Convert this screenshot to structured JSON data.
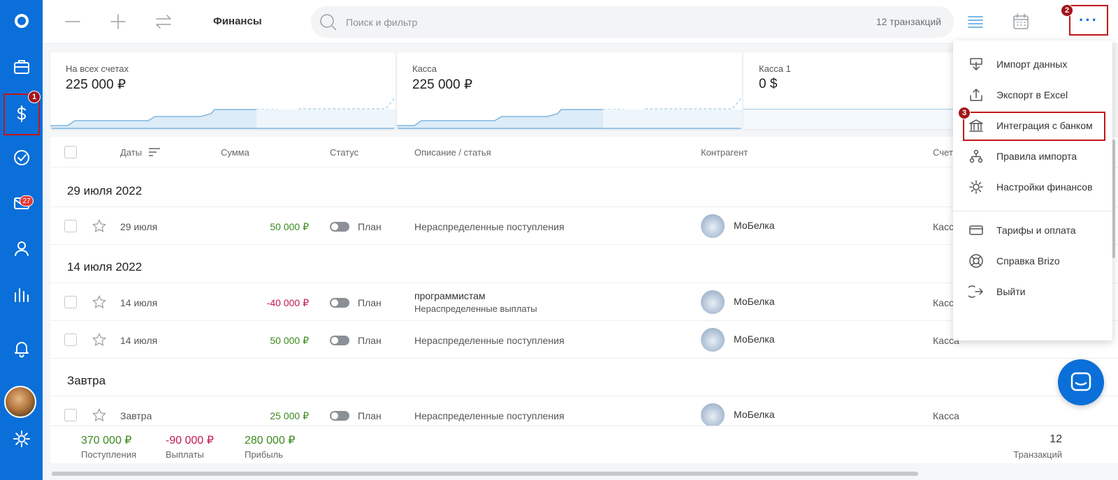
{
  "header": {
    "title": "Финансы",
    "search_placeholder": "Поиск и фильтр",
    "transaction_count": "12 транзакций",
    "more_label": "···"
  },
  "sidebar": {
    "mail_badge": "27"
  },
  "steps": {
    "s1": "1",
    "s2": "2",
    "s3": "3"
  },
  "cards": [
    {
      "label": "На всех счетах",
      "value": "225 000 ₽"
    },
    {
      "label": "Касса",
      "value": "225 000 ₽"
    },
    {
      "label": "Касса 1",
      "value": "0 $"
    }
  ],
  "table": {
    "headers": {
      "dates": "Даты",
      "amount": "Сумма",
      "status": "Статус",
      "description": "Описание / статья",
      "counterparty": "Контрагент",
      "account": "Счет"
    },
    "groups": [
      {
        "title": "29 июля 2022"
      },
      {
        "title": "14 июля 2022"
      },
      {
        "title": "Завтра"
      }
    ],
    "rows": [
      {
        "date": "29 июля",
        "amount": "50 000 ₽",
        "status": "План",
        "desc": "Нераспределенные поступления",
        "desc2": "",
        "counterparty": "МоБелка",
        "account": "Касса"
      },
      {
        "date": "14 июля",
        "amount": "-40 000 ₽",
        "status": "План",
        "desc": "программистам",
        "desc2": "Нераспределенные выплаты",
        "counterparty": "МоБелка",
        "account": "Касса"
      },
      {
        "date": "14 июля",
        "amount": "50 000 ₽",
        "status": "План",
        "desc": "Нераспределенные поступления",
        "desc2": "",
        "counterparty": "МоБелка",
        "account": "Касса"
      },
      {
        "date": "Завтра",
        "amount": "25 000 ₽",
        "status": "План",
        "desc": "Нераспределенные поступления",
        "desc2": "",
        "counterparty": "МоБелка",
        "account": "Касса"
      }
    ]
  },
  "footer": {
    "income_value": "370 000 ₽",
    "income_label": "Поступления",
    "expense_value": "-90 000 ₽",
    "expense_label": "Выплаты",
    "profit_value": "280 000 ₽",
    "profit_label": "Прибыль",
    "count_value": "12",
    "count_label": "Транзакций"
  },
  "menu": {
    "items": [
      {
        "label": "Импорт данных",
        "icon": "import-icon"
      },
      {
        "label": "Экспорт в Excel",
        "icon": "export-icon"
      },
      {
        "label": "Интеграция с банком",
        "icon": "bank-icon"
      },
      {
        "label": "Правила импорта",
        "icon": "rules-icon"
      },
      {
        "label": "Настройки финансов",
        "icon": "settings-icon"
      },
      {
        "label": "Тарифы и оплата",
        "icon": "card-icon"
      },
      {
        "label": "Справка Brizo",
        "icon": "help-icon"
      },
      {
        "label": "Выйти",
        "icon": "logout-icon"
      }
    ]
  },
  "colors": {
    "sidebar": "#0a6fd8",
    "positive": "#3a8a1e",
    "negative": "#c2185b",
    "highlight": "#c0161a"
  }
}
